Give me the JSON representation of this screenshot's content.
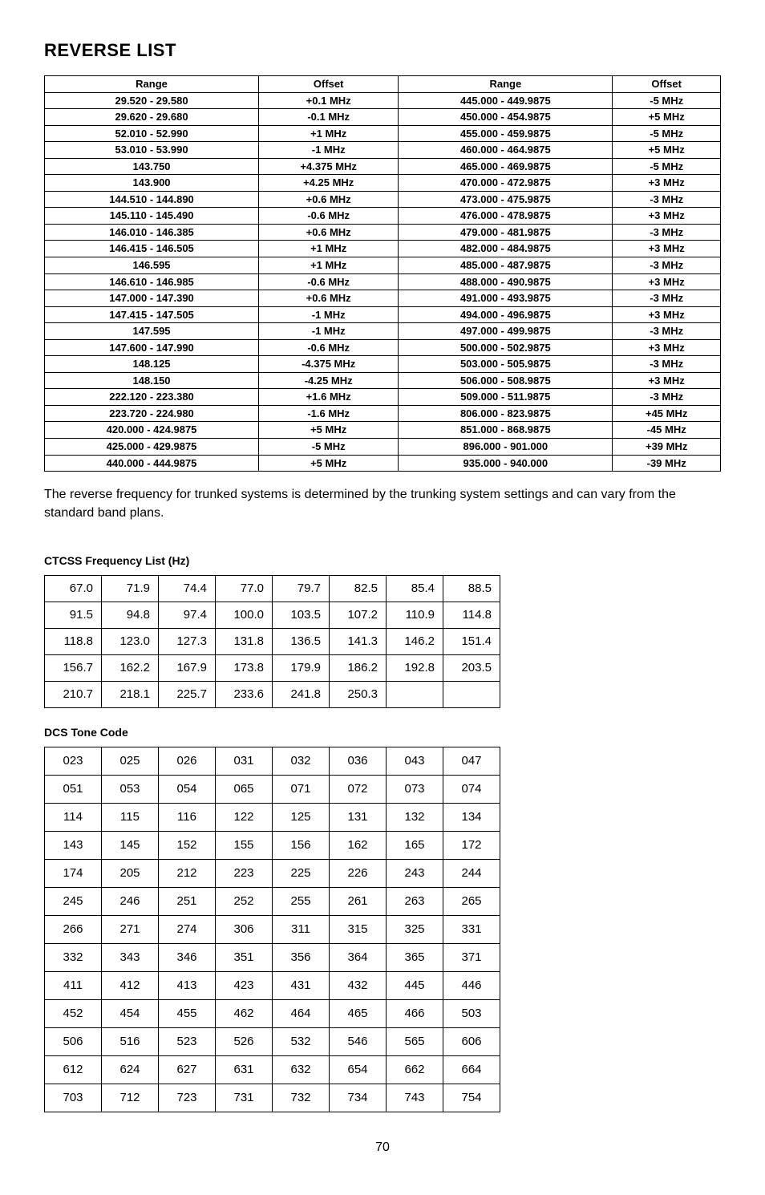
{
  "title": "REVERSE LIST",
  "reverse_headers": [
    "Range",
    "Offset",
    "Range",
    "Offset"
  ],
  "reverse_rows": [
    [
      "29.520 - 29.580",
      "+0.1 MHz",
      "445.000 - 449.9875",
      "-5 MHz"
    ],
    [
      "29.620 - 29.680",
      "-0.1 MHz",
      "450.000 - 454.9875",
      "+5 MHz"
    ],
    [
      "52.010 - 52.990",
      "+1 MHz",
      "455.000 - 459.9875",
      "-5 MHz"
    ],
    [
      "53.010 - 53.990",
      "-1 MHz",
      "460.000 - 464.9875",
      "+5 MHz"
    ],
    [
      "143.750",
      "+4.375 MHz",
      "465.000 - 469.9875",
      "-5 MHz"
    ],
    [
      "143.900",
      "+4.25 MHz",
      "470.000 - 472.9875",
      "+3 MHz"
    ],
    [
      "144.510 - 144.890",
      "+0.6 MHz",
      "473.000 - 475.9875",
      "-3 MHz"
    ],
    [
      "145.110 - 145.490",
      "-0.6 MHz",
      "476.000 - 478.9875",
      "+3 MHz"
    ],
    [
      "146.010 - 146.385",
      "+0.6 MHz",
      "479.000 - 481.9875",
      "-3 MHz"
    ],
    [
      "146.415 - 146.505",
      "+1 MHz",
      "482.000 - 484.9875",
      "+3 MHz"
    ],
    [
      "146.595",
      "+1 MHz",
      "485.000 - 487.9875",
      "-3 MHz"
    ],
    [
      "146.610 - 146.985",
      "-0.6 MHz",
      "488.000 - 490.9875",
      "+3 MHz"
    ],
    [
      "147.000 - 147.390",
      "+0.6 MHz",
      "491.000 - 493.9875",
      "-3 MHz"
    ],
    [
      "147.415 - 147.505",
      "-1 MHz",
      "494.000 - 496.9875",
      "+3 MHz"
    ],
    [
      "147.595",
      "-1 MHz",
      "497.000 - 499.9875",
      "-3 MHz"
    ],
    [
      "147.600 - 147.990",
      "-0.6 MHz",
      "500.000 - 502.9875",
      "+3 MHz"
    ],
    [
      "148.125",
      "-4.375 MHz",
      "503.000 - 505.9875",
      "-3 MHz"
    ],
    [
      "148.150",
      "-4.25 MHz",
      "506.000 - 508.9875",
      "+3 MHz"
    ],
    [
      "222.120 - 223.380",
      "+1.6 MHz",
      "509.000 - 511.9875",
      "-3 MHz"
    ],
    [
      "223.720 - 224.980",
      "-1.6 MHz",
      "806.000 - 823.9875",
      "+45 MHz"
    ],
    [
      "420.000 - 424.9875",
      "+5 MHz",
      "851.000 - 868.9875",
      "-45 MHz"
    ],
    [
      "425.000 - 429.9875",
      "-5 MHz",
      "896.000 - 901.000",
      "+39 MHz"
    ],
    [
      "440.000 - 444.9875",
      "+5 MHz",
      "935.000 - 940.000",
      "-39 MHz"
    ]
  ],
  "note_text": "The reverse frequency for trunked systems is determined by the trunking system settings and can vary from the standard band plans.",
  "ctcss_title": "CTCSS Frequency List (Hz)",
  "ctcss_rows": [
    [
      "67.0",
      "71.9",
      "74.4",
      "77.0",
      "79.7",
      "82.5",
      "85.4",
      "88.5"
    ],
    [
      "91.5",
      "94.8",
      "97.4",
      "100.0",
      "103.5",
      "107.2",
      "110.9",
      "114.8"
    ],
    [
      "118.8",
      "123.0",
      "127.3",
      "131.8",
      "136.5",
      "141.3",
      "146.2",
      "151.4"
    ],
    [
      "156.7",
      "162.2",
      "167.9",
      "173.8",
      "179.9",
      "186.2",
      "192.8",
      "203.5"
    ],
    [
      "210.7",
      "218.1",
      "225.7",
      "233.6",
      "241.8",
      "250.3",
      "",
      ""
    ]
  ],
  "dcs_title": "DCS Tone Code",
  "dcs_rows": [
    [
      "023",
      "025",
      "026",
      "031",
      "032",
      "036",
      "043",
      "047"
    ],
    [
      "051",
      "053",
      "054",
      "065",
      "071",
      "072",
      "073",
      "074"
    ],
    [
      "114",
      "115",
      "116",
      "122",
      "125",
      "131",
      "132",
      "134"
    ],
    [
      "143",
      "145",
      "152",
      "155",
      "156",
      "162",
      "165",
      "172"
    ],
    [
      "174",
      "205",
      "212",
      "223",
      "225",
      "226",
      "243",
      "244"
    ],
    [
      "245",
      "246",
      "251",
      "252",
      "255",
      "261",
      "263",
      "265"
    ],
    [
      "266",
      "271",
      "274",
      "306",
      "311",
      "315",
      "325",
      "331"
    ],
    [
      "332",
      "343",
      "346",
      "351",
      "356",
      "364",
      "365",
      "371"
    ],
    [
      "411",
      "412",
      "413",
      "423",
      "431",
      "432",
      "445",
      "446"
    ],
    [
      "452",
      "454",
      "455",
      "462",
      "464",
      "465",
      "466",
      "503"
    ],
    [
      "506",
      "516",
      "523",
      "526",
      "532",
      "546",
      "565",
      "606"
    ],
    [
      "612",
      "624",
      "627",
      "631",
      "632",
      "654",
      "662",
      "664"
    ],
    [
      "703",
      "712",
      "723",
      "731",
      "732",
      "734",
      "743",
      "754"
    ]
  ],
  "page_number": "70"
}
